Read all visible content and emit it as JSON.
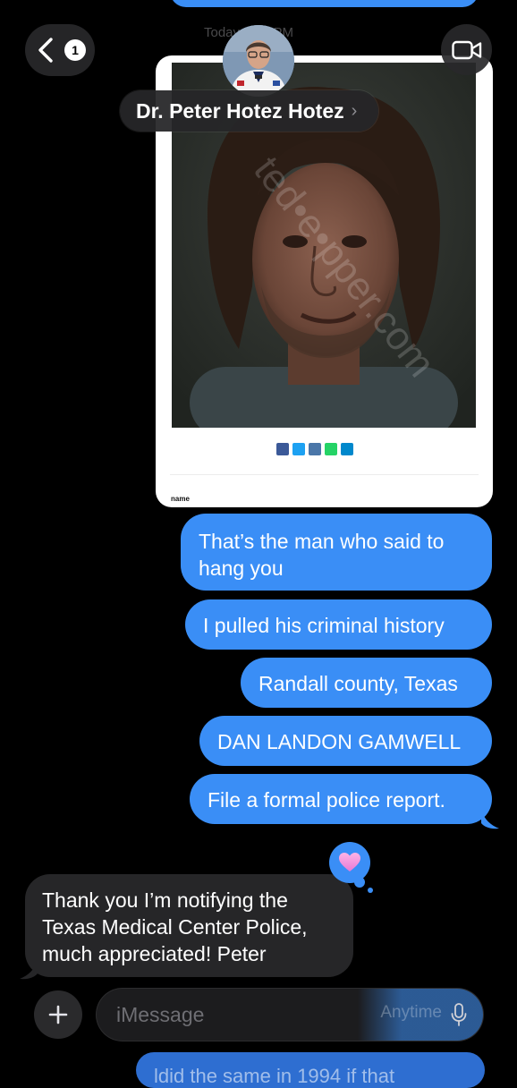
{
  "header": {
    "back_badge": "1",
    "contact_name": "Dr. Peter Hotez Hotez",
    "contact_chevron": "›",
    "timestamp": "Today 4:41 PM"
  },
  "attachment": {
    "footer_label": "name",
    "share_icons": [
      "facebook-icon",
      "twitter-icon",
      "reddit-icon",
      "whatsapp-icon",
      "telegram-icon"
    ],
    "share_colors": [
      "#3b5998",
      "#1da1f2",
      "#4a76a8",
      "#25d366",
      "#0088cc"
    ]
  },
  "messages": [
    {
      "from": "me",
      "text": "That’s the man who said to hang you"
    },
    {
      "from": "me",
      "text": "I pulled his criminal history"
    },
    {
      "from": "me",
      "text": "Randall county, Texas"
    },
    {
      "from": "me",
      "text": "DAN LANDON GAMWELL"
    },
    {
      "from": "me",
      "text": "File a formal police report."
    },
    {
      "from": "them",
      "text": "Thank you I’m notifying the Texas Medical Center Police, much appreciated! Peter",
      "tapback": "heart"
    }
  ],
  "compose": {
    "placeholder": "iMessage",
    "ghost_text": "Anytime",
    "next_preview": "ldid the same in 1994 if that"
  },
  "colors": {
    "sent_bubble": "#3a8ef6",
    "received_bubble": "#262628",
    "background": "#000000"
  }
}
